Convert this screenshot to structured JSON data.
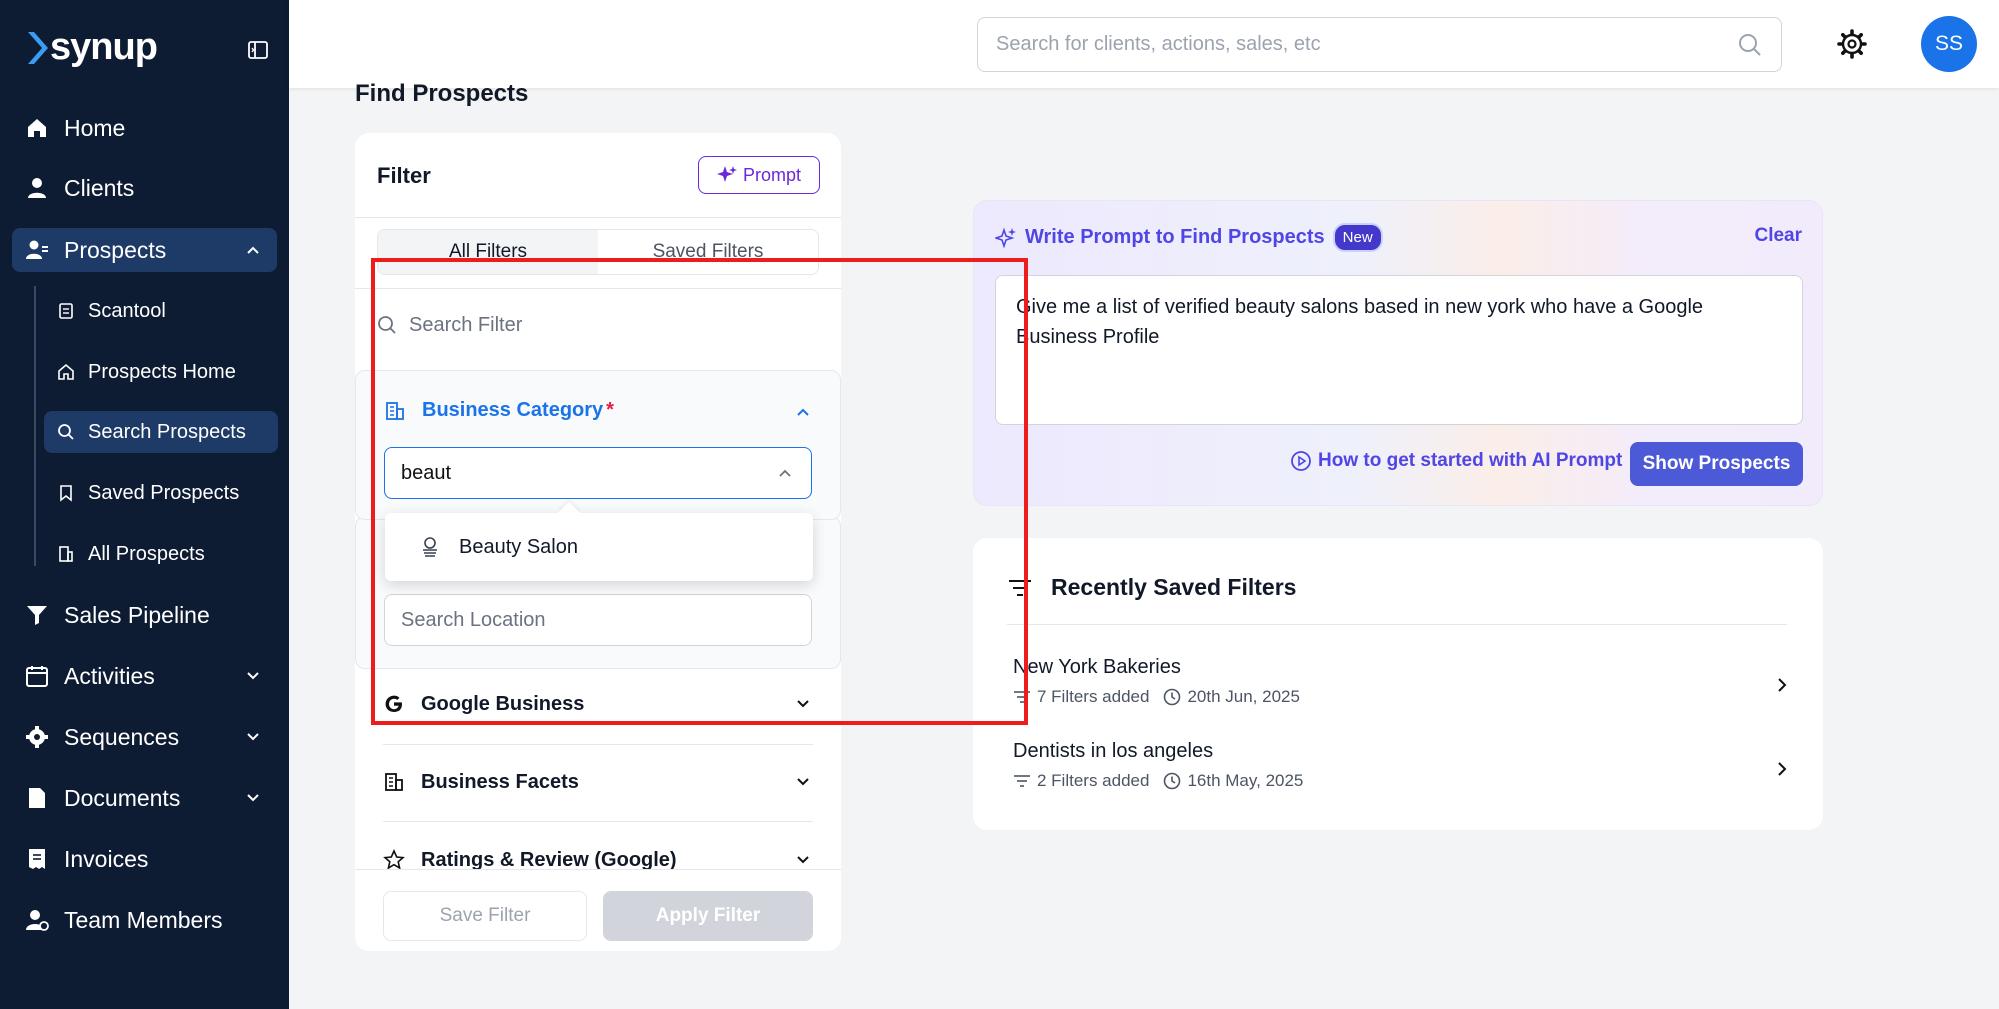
{
  "brand": {
    "name": "synup"
  },
  "sidebar": {
    "items": [
      {
        "label": "Home",
        "icon": "home-icon"
      },
      {
        "label": "Clients",
        "icon": "user-icon"
      },
      {
        "label": "Prospects",
        "icon": "users-icon",
        "expanded": true
      },
      {
        "label": "Sales Pipeline",
        "icon": "funnel-icon"
      },
      {
        "label": "Activities",
        "icon": "calendar-icon"
      },
      {
        "label": "Sequences",
        "icon": "gear-badge-icon"
      },
      {
        "label": "Documents",
        "icon": "document-icon"
      },
      {
        "label": "Invoices",
        "icon": "receipt-icon"
      },
      {
        "label": "Team Members",
        "icon": "team-icon"
      }
    ],
    "prospects_sub": [
      {
        "label": "Scantool"
      },
      {
        "label": "Prospects Home"
      },
      {
        "label": "Search Prospects",
        "active": true
      },
      {
        "label": "Saved Prospects"
      },
      {
        "label": "All Prospects"
      }
    ]
  },
  "topbar": {
    "search_placeholder": "Search for clients, actions, sales, etc",
    "avatar_initials": "SS"
  },
  "page": {
    "title": "Find Prospects"
  },
  "filter": {
    "title": "Filter",
    "prompt_button": "Prompt",
    "tabs": [
      "All Filters",
      "Saved Filters"
    ],
    "search_placeholder": "Search Filter",
    "business_category": {
      "label": "Business Category",
      "required_mark": "*",
      "input_value": "beaut",
      "suggestion": "Beauty Salon"
    },
    "location_placeholder": "Search Location",
    "sections": [
      "Google Business",
      "Business Facets",
      "Ratings & Review (Google)"
    ],
    "save_button": "Save Filter",
    "apply_button": "Apply Filter"
  },
  "prompt_card": {
    "title": "Write Prompt to Find Prospects",
    "badge": "New",
    "clear": "Clear",
    "prompt_text": "Give me a list of verified beauty salons based in new york who have a Google Business Profile",
    "howto": "How to get started with AI Prompt",
    "show_button": "Show Prospects"
  },
  "recent": {
    "title": "Recently Saved Filters",
    "rows": [
      {
        "name": "New York Bakeries",
        "filters": "7 Filters added",
        "date": "20th Jun, 2025"
      },
      {
        "name": "Dentists in los angeles",
        "filters": "2 Filters added",
        "date": "16th May, 2025"
      }
    ]
  },
  "colors": {
    "sidebar": "#0d1b33",
    "accent": "#1a73e8",
    "prompt_accent": "#4f46e5",
    "highlight_box": "#ee1c1c"
  }
}
